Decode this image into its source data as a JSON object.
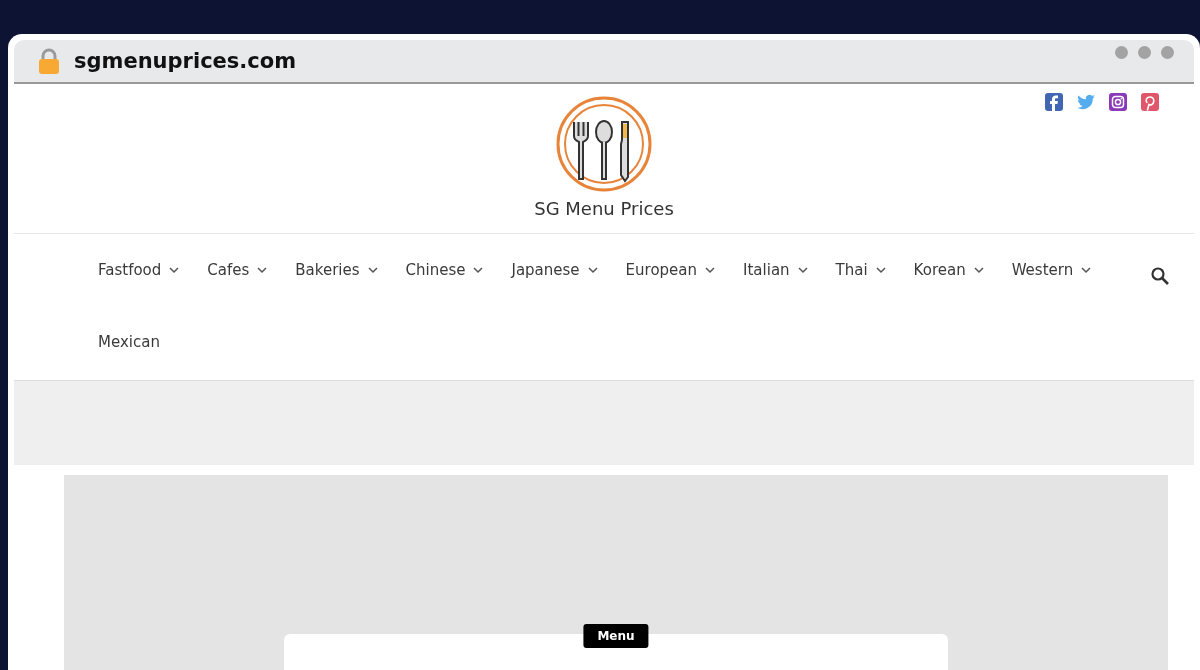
{
  "browser": {
    "address": "sgmenuprices.com"
  },
  "site": {
    "title": "SG Menu Prices"
  },
  "nav": [
    {
      "label": "Fastfood",
      "dropdown": true
    },
    {
      "label": "Cafes",
      "dropdown": true
    },
    {
      "label": "Bakeries",
      "dropdown": true
    },
    {
      "label": "Chinese",
      "dropdown": true
    },
    {
      "label": "Japanese",
      "dropdown": true
    },
    {
      "label": "European",
      "dropdown": true
    },
    {
      "label": "Italian",
      "dropdown": true
    },
    {
      "label": "Thai",
      "dropdown": true
    },
    {
      "label": "Korean",
      "dropdown": true
    },
    {
      "label": "Western",
      "dropdown": true
    },
    {
      "label": "Mexican",
      "dropdown": false
    }
  ],
  "card": {
    "badge": "Menu"
  }
}
